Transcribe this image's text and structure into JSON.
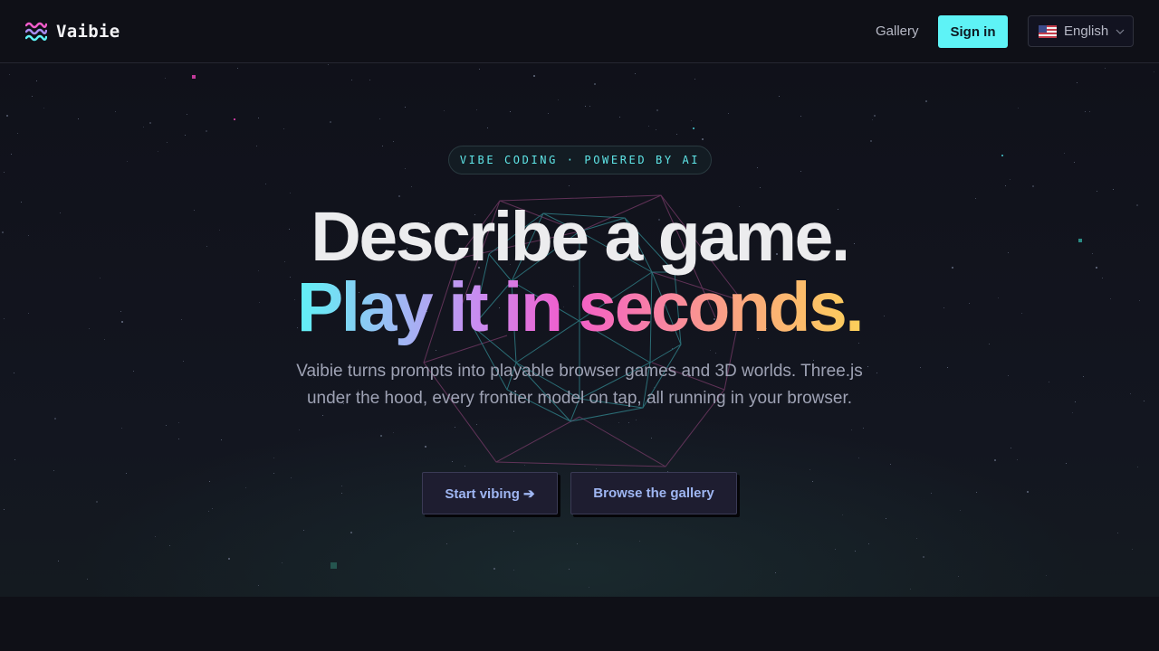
{
  "header": {
    "brand_name": "Vaibie",
    "nav": {
      "gallery_label": "Gallery"
    },
    "sign_in_label": "Sign in",
    "language": {
      "selected": "English",
      "flag_icon": "us-flag-icon"
    }
  },
  "hero": {
    "badge": "VIBE CODING · POWERED BY AI",
    "headline_line1": "Describe a game.",
    "headline_line2": "Play it in seconds.",
    "subtitle": "Vaibie turns prompts into playable browser games and 3D worlds. Three.js under the hood, every frontier model on tap, all running in your browser.",
    "cta_primary": "Start vibing ➔",
    "cta_secondary": "Browse the gallery"
  },
  "colors": {
    "background": "#0f1017",
    "accent_cyan": "#5ef3f6",
    "gradient": [
      "#5ff2f5",
      "#c98cf0",
      "#f25ccb",
      "#fbaa7a",
      "#fcd05a"
    ]
  }
}
